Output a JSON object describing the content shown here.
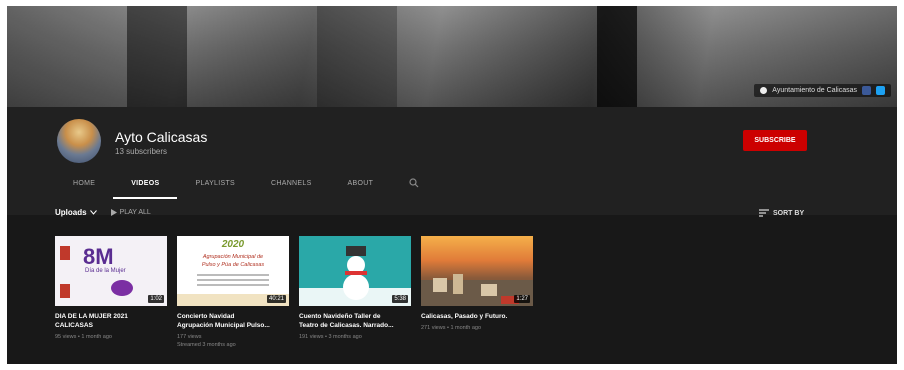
{
  "channel": {
    "name": "Ayto Calicasas",
    "subscribers": "13 subscribers",
    "subscribe_label": "SUBSCRIBE",
    "banner_link": "Ayuntamiento de Calicasas"
  },
  "tabs": [
    {
      "label": "HOME"
    },
    {
      "label": "VIDEOS"
    },
    {
      "label": "PLAYLISTS"
    },
    {
      "label": "CHANNELS"
    },
    {
      "label": "ABOUT"
    }
  ],
  "active_tab": "VIDEOS",
  "uploads": {
    "label": "Uploads",
    "play_all": "PLAY ALL",
    "sort_by": "SORT BY"
  },
  "videos": [
    {
      "title_line1": "DIA DE LA MUJER 2021",
      "title_line2": "CALICASAS",
      "meta1": "95 views • 1 month ago",
      "meta2": "",
      "duration": "1:02",
      "thumb_big": "8M",
      "thumb_small": "Día de la Mujer"
    },
    {
      "title_line1": "Concierto Navidad",
      "title_line2": "Agrupación Municipal Pulso...",
      "meta1": "177 views",
      "meta2": "Streamed 3 months ago",
      "duration": "40:21",
      "thumb_year": "2020",
      "thumb_text1": "Agrupación Municipal de",
      "thumb_text2": "Pulso y Púa de Calicasas"
    },
    {
      "title_line1": "Cuento Navideño Taller de",
      "title_line2": "Teatro de Calicasas. Narrado...",
      "meta1": "191 views • 3 months ago",
      "meta2": "",
      "duration": "5:38"
    },
    {
      "title_line1": "Calicasas, Pasado y Futuro.",
      "title_line2": "",
      "meta1": "271 views • 1 month ago",
      "meta2": "",
      "duration": "1:27"
    }
  ],
  "colors": {
    "subscribe_bg": "#cc0000",
    "page_bg": "#181818",
    "header_bg": "#212121"
  }
}
